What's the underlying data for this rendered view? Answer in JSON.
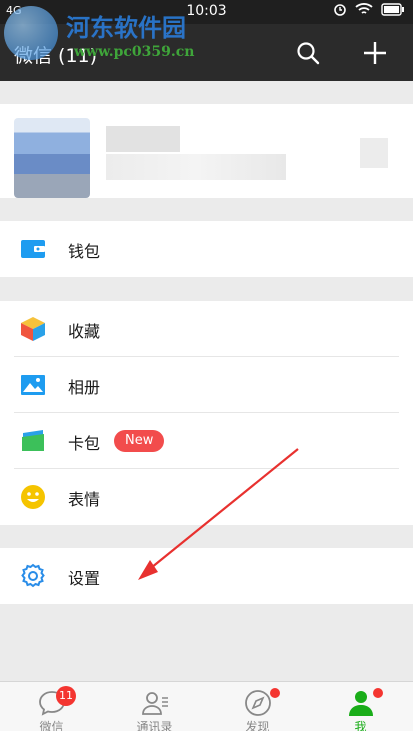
{
  "status_bar": {
    "network": "4G",
    "time": "10:03"
  },
  "nav": {
    "title": "微信 (11)"
  },
  "watermark": {
    "title": "河东软件园",
    "url": "www.pc0359.cn"
  },
  "menu": {
    "wallet": {
      "label": "钱包",
      "icon": "wallet-icon",
      "color": "#1e9cf0"
    },
    "favorites": {
      "label": "收藏",
      "icon": "cube-icon"
    },
    "album": {
      "label": "相册",
      "icon": "album-icon",
      "color": "#1e9cf0"
    },
    "cards": {
      "label": "卡包",
      "icon": "cards-icon",
      "badge": "New"
    },
    "stickers": {
      "label": "表情",
      "icon": "smiley-icon",
      "color": "#f5c400"
    },
    "settings": {
      "label": "设置",
      "icon": "gear-icon",
      "color": "#2a8de8"
    }
  },
  "tabs": [
    {
      "label": "微信",
      "icon": "chat-icon",
      "badge": "11"
    },
    {
      "label": "通讯录",
      "icon": "contacts-icon"
    },
    {
      "label": "发现",
      "icon": "compass-icon"
    },
    {
      "label": "我",
      "icon": "me-icon",
      "active": true
    }
  ],
  "colors": {
    "accent": "#1aad19",
    "badge": "#f43530",
    "nav_bg": "#2b2b2b"
  }
}
